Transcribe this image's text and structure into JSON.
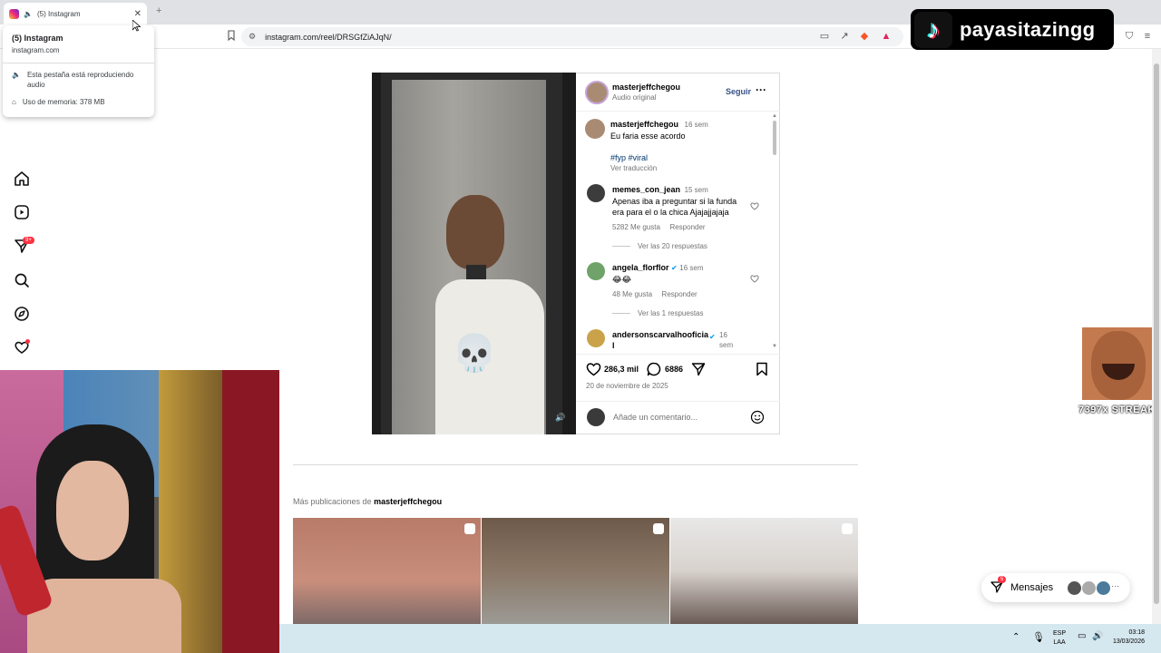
{
  "browser": {
    "tab_title": "(5) Instagram",
    "url": "instagram.com/reel/DRSGfZiAJqN/",
    "tooltip": {
      "title": "(5) Instagram",
      "host": "instagram.com",
      "audio_text": "Esta pestaña está reproduciendo audio",
      "memory_text": "Uso de memoria: 378 MB"
    }
  },
  "overlay": {
    "tiktok_logo": "♪",
    "tiktok_name": "payasitazingg",
    "streak_text": "7397x STREAK"
  },
  "nav": {
    "notifications_badge": "9+"
  },
  "post": {
    "author": "masterjeffchegou",
    "audio_label": "Audio original",
    "follow_label": "Seguir",
    "caption": {
      "user": "masterjeffchegou",
      "time": "16 sem",
      "text": "Eu faria esse acordo",
      "hashtags": "#fyp #viral",
      "translate": "Ver traducción"
    },
    "comments": [
      {
        "user": "memes_con_jean",
        "time": "15 sem",
        "text": "Apenas iba a preguntar si la funda era para el o la chica Ajajajjajaja",
        "likes": "5282 Me gusta",
        "reply": "Responder",
        "view_replies": "Ver las 20 respuestas"
      },
      {
        "user": "angela_florflor",
        "time": "16 sem",
        "text": "😂😂",
        "likes": "48 Me gusta",
        "reply": "Responder",
        "view_replies": "Ver las 1 respuestas"
      },
      {
        "user": "andersonscarvalhooficia l",
        "time": "16 sem",
        "text": ""
      }
    ],
    "like_count": "286,3 mil",
    "comment_count": "6886",
    "date": "20 de noviembre de 2025",
    "add_comment_placeholder": "Añade un comentario..."
  },
  "more": {
    "prefix": "Más publicaciones de ",
    "user": "masterjeffchegou"
  },
  "messages": {
    "label": "Mensajes",
    "badge": "5"
  },
  "taskbar": {
    "lang_top": "ESP",
    "lang_bottom": "LAA",
    "time": "03:18",
    "date": "13/03/2026"
  },
  "colors": {
    "ig_blue": "#385185",
    "follow_blue": "#0095f6",
    "badge_red": "#ff3040",
    "taskbar": "#d6e8ef"
  }
}
